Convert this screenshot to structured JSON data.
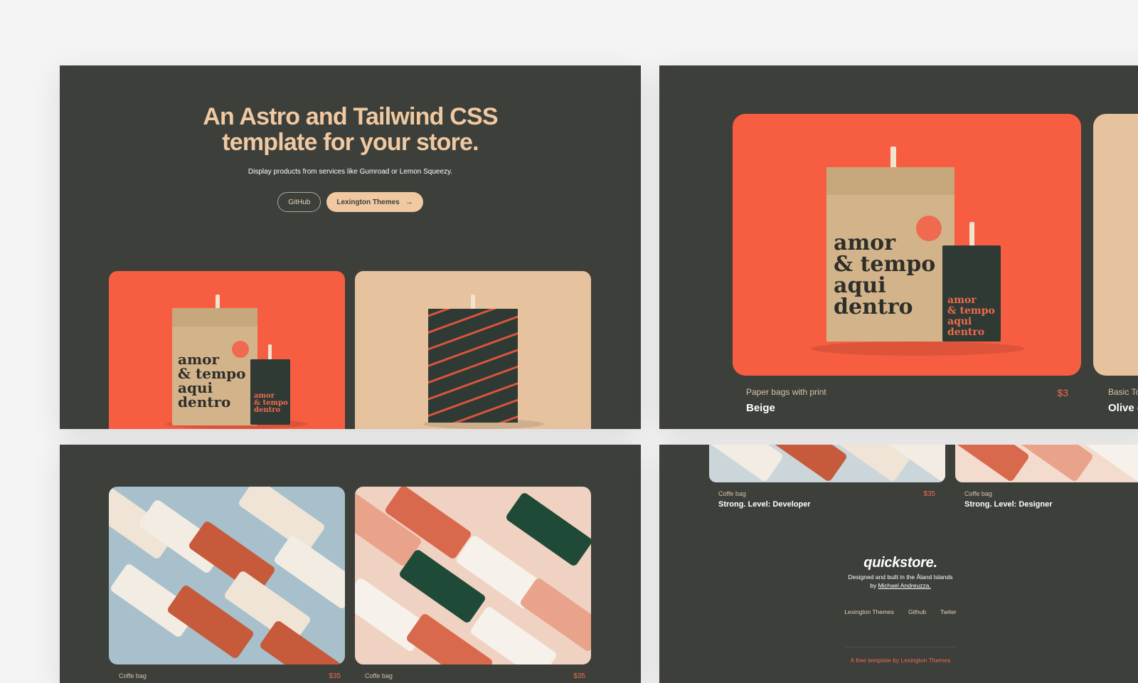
{
  "hero": {
    "title_line1": "An Astro and Tailwind CSS",
    "title_line2": "template for your store.",
    "subtitle": "Display products from services like Gumroad or Lemon Squeezy.",
    "buttons": {
      "github": "GitHub",
      "lexington": "Lexington Themes",
      "arrow": "→"
    }
  },
  "bag_print": {
    "line1": "amor",
    "line2": "& tempo",
    "line3": "aqui",
    "line4": "dentro"
  },
  "featured_product": {
    "category": "Paper bags with print",
    "name": "Beige",
    "price": "$3",
    "next_category": "Basic To",
    "next_name": "Olive c"
  },
  "coffee_products": [
    {
      "category": "Coffe bag",
      "price": "$35"
    },
    {
      "category": "Coffe bag",
      "price": "$35"
    }
  ],
  "strip_products": [
    {
      "category": "Coffe bag",
      "name": "Strong. Level: Developer",
      "price": "$35"
    },
    {
      "category": "Coffe bag",
      "name": "Strong. Level: Designer"
    }
  ],
  "footer": {
    "brand": "quickstore.",
    "designed_line1": "Designed and built in the Åland Islands",
    "by_prefix": "by ",
    "author": "Michael Andreuzza.",
    "links": [
      "Lexington Themes",
      "Github",
      "Twiter"
    ],
    "credit": "A free template by Lexington Themes"
  },
  "colors": {
    "panel": "#3c3f3a",
    "accent_orange": "#f75e41",
    "accent_beige": "#e6c29e",
    "title_peach": "#f0c9a2",
    "price": "#f06a4f"
  },
  "icons": {
    "button_arrow": "arrow-right-icon"
  }
}
